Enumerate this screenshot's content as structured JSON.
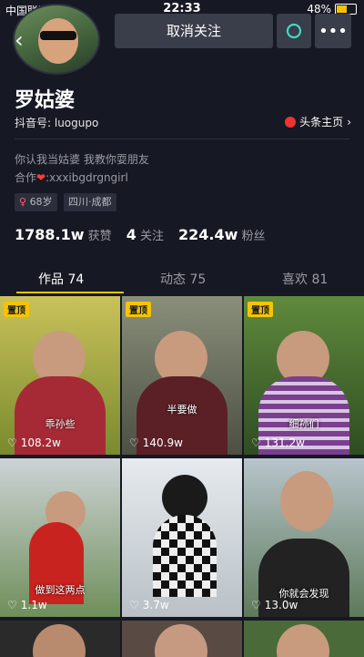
{
  "status_bar": {
    "carrier": "中国联通",
    "time": "22:33",
    "battery": "48%",
    "battery_level": 0.48
  },
  "header": {
    "unfollow_label": "取消关注",
    "back_icon": "chevron-left-icon",
    "chat_icon": "chat-icon",
    "more_icon": "more-icon"
  },
  "profile": {
    "name": "罗姑婆",
    "douyin_id": "抖音号: luogupo",
    "toutiao_label": "头条主页",
    "bio_line1": "你认我当姑婆 我教你耍朋友",
    "bio_line2_prefix": "合作",
    "bio_line2_suffix": ":xxxibgdrgngirl",
    "age_tag": "68岁",
    "location_tag": "四川·成都"
  },
  "stats": {
    "likes_value": "1788.1w",
    "likes_label": "获赞",
    "following_value": "4",
    "following_label": "关注",
    "followers_value": "224.4w",
    "followers_label": "粉丝"
  },
  "tabs": {
    "works": "作品 74",
    "dynamics": "动态 75",
    "likes": "喜欢 81"
  },
  "videos": [
    {
      "pinned": "置顶",
      "likes": "108.2w",
      "caption": "乖孙些"
    },
    {
      "pinned": "置顶",
      "likes": "140.9w",
      "caption": "半要做"
    },
    {
      "pinned": "置顶",
      "likes": "131.2w",
      "caption": "细孙们"
    },
    {
      "pinned": "",
      "likes": "1.1w",
      "caption": "做到这两点"
    },
    {
      "pinned": "",
      "likes": "3.7w",
      "caption": ""
    },
    {
      "pinned": "",
      "likes": "13.0w",
      "caption": "你就会发现"
    }
  ]
}
